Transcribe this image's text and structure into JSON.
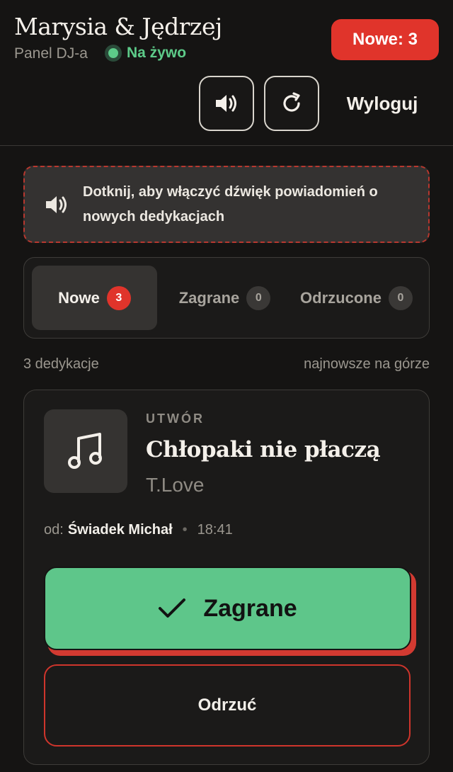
{
  "header": {
    "title": "Marysia & Jędrzej",
    "subtitle": "Panel DJ-a",
    "live_label": "Na żywo",
    "new_pill": "Nowe: 3",
    "logout_label": "Wyloguj",
    "sound_icon": "speaker-icon",
    "refresh_icon": "refresh-icon"
  },
  "notice": {
    "text": "Dotknij, aby włączyć dźwięk powiadomień o nowych dedykacjach",
    "icon": "speaker-icon"
  },
  "tabs": [
    {
      "label": "Nowe",
      "count": "3",
      "active": true
    },
    {
      "label": "Zagrane",
      "count": "0",
      "active": false
    },
    {
      "label": "Odrzucone",
      "count": "0",
      "active": false
    }
  ],
  "list": {
    "count_label": "3 dedykacje",
    "sort_label": "najnowsze na górze"
  },
  "request": {
    "kind": "UTWÓR",
    "song": "Chłopaki nie płaczą",
    "artist": "T.Love",
    "from_prefix": "od:",
    "from_name": "Świadek Michał",
    "separator": "•",
    "time": "18:41",
    "icon": "music-note-icon",
    "play_label": "Zagrane",
    "play_icon": "checkmark-icon",
    "reject_label": "Odrzuć"
  },
  "colors": {
    "accent_red": "#e0342b",
    "accent_green": "#5ec68a",
    "live_green": "#5dcb89",
    "background": "#151413"
  }
}
